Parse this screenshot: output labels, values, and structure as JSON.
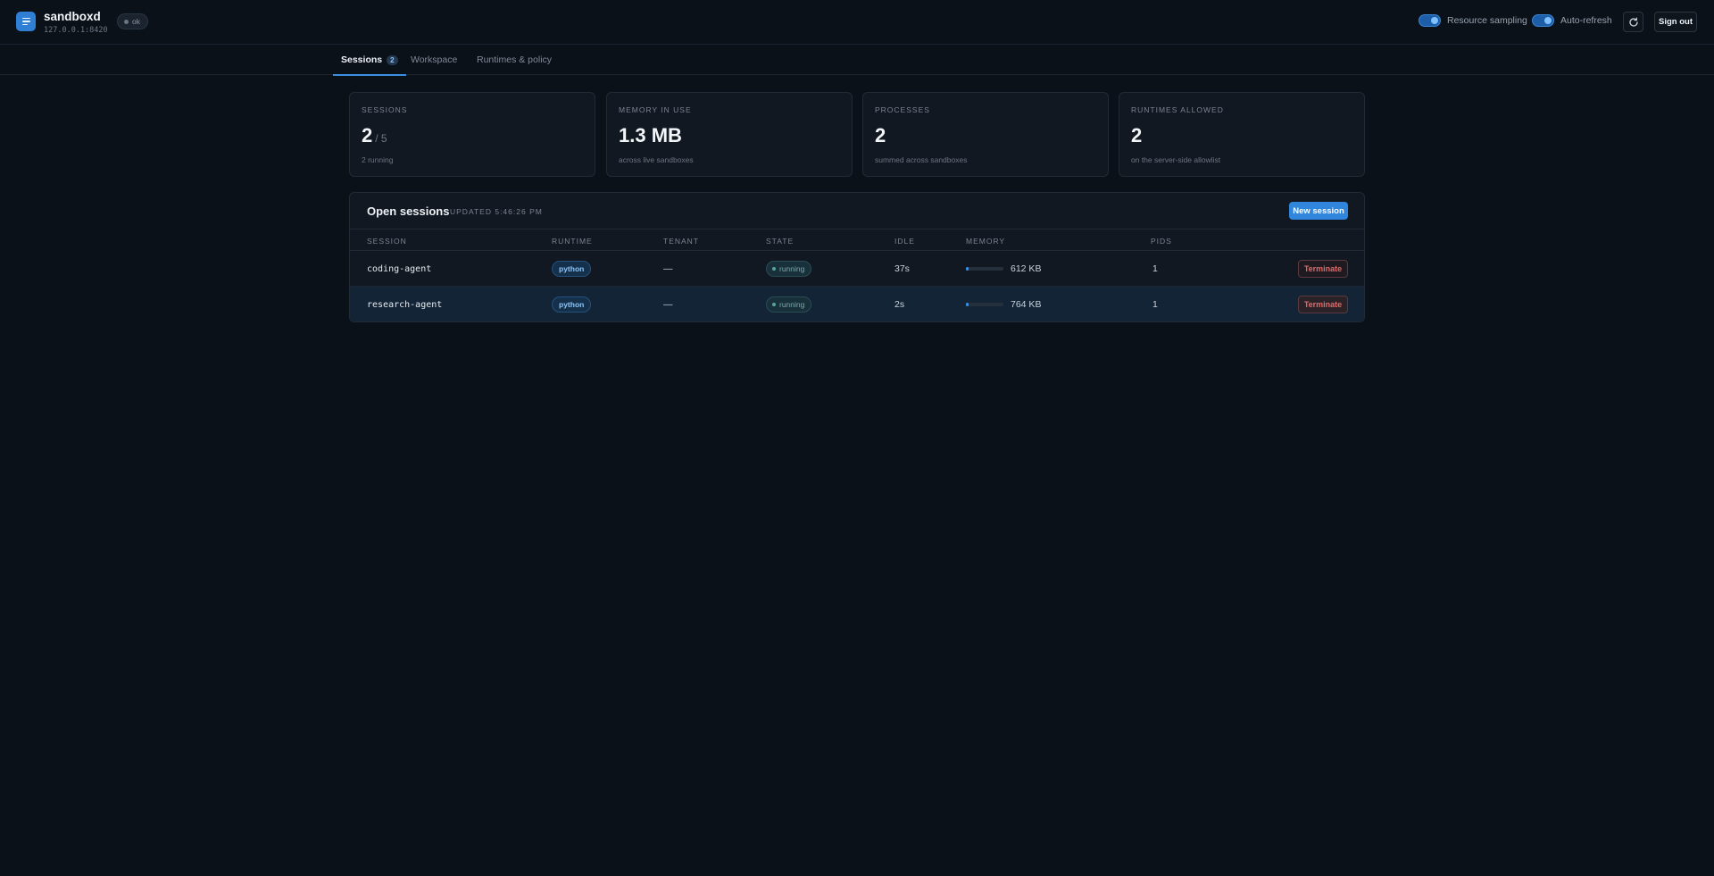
{
  "app": {
    "name": "sandboxd",
    "host": "127.0.0.1:8420",
    "status": "ok"
  },
  "header": {
    "resource_sampling_label": "Resource sampling",
    "resource_sampling_on": true,
    "auto_refresh_label": "Auto-refresh",
    "auto_refresh_on": true,
    "refresh_icon": "refresh-icon",
    "sign_out_label": "Sign out"
  },
  "tabs": [
    {
      "label": "Sessions",
      "count": "2",
      "active": true
    },
    {
      "label": "Workspace",
      "active": false
    },
    {
      "label": "Runtimes & policy",
      "active": false
    }
  ],
  "stats": [
    {
      "label": "SESSIONS",
      "value": "2",
      "denominator": "/ 5",
      "sub": "2 running"
    },
    {
      "label": "MEMORY IN USE",
      "value": "1.3 MB",
      "sub": "across live sandboxes"
    },
    {
      "label": "PROCESSES",
      "value": "2",
      "sub": "summed across sandboxes"
    },
    {
      "label": "RUNTIMES ALLOWED",
      "value": "2",
      "sub": "on the server-side allowlist"
    }
  ],
  "sessions_panel": {
    "title": "Open sessions",
    "updated": "UPDATED 5:46:26 PM",
    "new_session_label": "New session",
    "columns": [
      "SESSION",
      "RUNTIME",
      "TENANT",
      "STATE",
      "IDLE",
      "MEMORY",
      "PIDS"
    ],
    "rows": [
      {
        "session": "coding-agent",
        "runtime": "python",
        "tenant": "—",
        "state": "running",
        "idle": "37s",
        "memory": "612 KB",
        "memory_fraction": 0.08,
        "pids": "1",
        "action": "Terminate"
      },
      {
        "session": "research-agent",
        "runtime": "python",
        "tenant": "—",
        "state": "running",
        "idle": "2s",
        "memory": "764 KB",
        "memory_fraction": 0.08,
        "pids": "1",
        "action": "Terminate"
      }
    ]
  },
  "colors": {
    "accent": "#2f86dc",
    "danger": "#e06a6a",
    "background": "#0b1119"
  }
}
